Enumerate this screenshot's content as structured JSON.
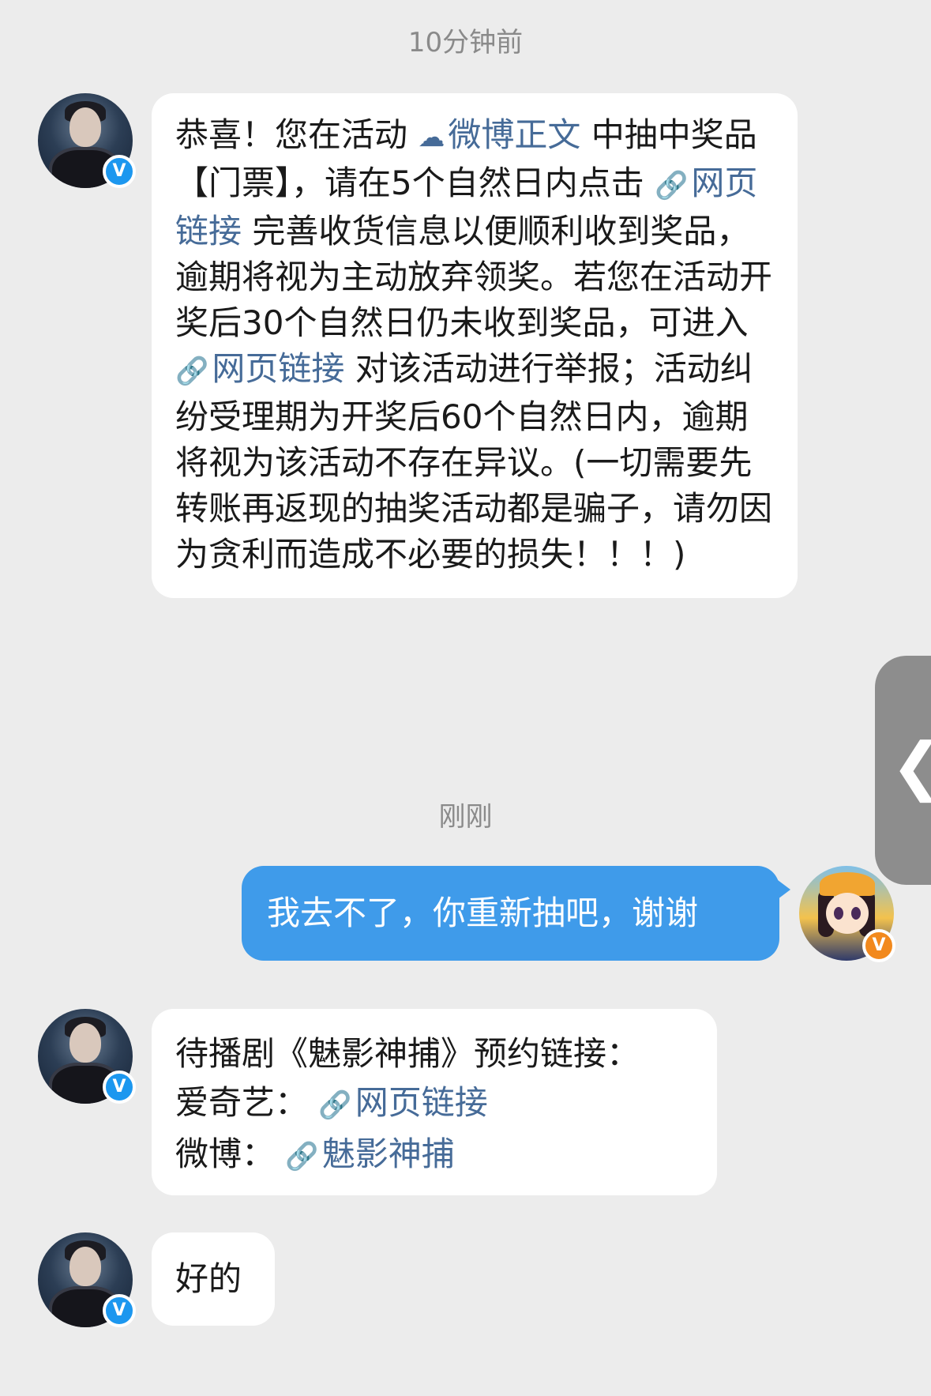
{
  "messages": {
    "ts1": "10分钟前",
    "msg1": {
      "p1": "恭喜！您在活动 ",
      "link1_icon": "☁",
      "link1": "微博正文",
      "p2": " 中抽中奖品【门票】，请在5个自然日内点击 ",
      "link2_icon": "🔗",
      "link2": "网页链接",
      "p3": " 完善收货信息以便顺利收到奖品，逾期将视为主动放弃领奖。若您在活动开奖后30个自然日仍未收到奖品，可进入 ",
      "link3_icon": "🔗",
      "link3": "网页链接",
      "p4": " 对该活动进行举报；活动纠纷受理期为开奖后60个自然日内，逾期将视为该活动不存在异议。(一切需要先转账再返现的抽奖活动都是骗子，请勿因为贪利而造成不必要的损失！！！)"
    },
    "ts2": "刚刚",
    "msg2": "我去不了，你重新抽吧，谢谢",
    "msg3": {
      "line1": "待播剧《魅影神捕》预约链接：",
      "line2_label": "爱奇艺：",
      "line2_icon": "🔗",
      "line2_link": "网页链接",
      "line3_label": "微博：",
      "line3_icon": "🔗",
      "line3_link": "魅影神捕"
    },
    "msg4": "好的"
  },
  "badges": {
    "verified_blue": "V",
    "verified_orange": "V"
  },
  "side_handle": {
    "icon": "❮"
  },
  "colors": {
    "background": "#ececec",
    "link": "#466b98",
    "my_bubble": "#3f9bea",
    "verified_blue": "#1c97ef",
    "verified_orange": "#f2891d"
  }
}
